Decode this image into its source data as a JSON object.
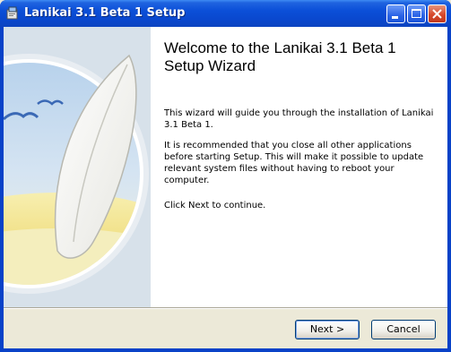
{
  "window": {
    "title": "Lanikai 3.1 Beta 1 Setup"
  },
  "wizard": {
    "heading": "Welcome to the Lanikai 3.1 Beta 1 Setup Wizard",
    "paragraphs": [
      "This wizard will guide you through the installation of Lanikai 3.1 Beta 1.",
      "It is recommended that you close all other applications before starting Setup. This will make it possible to update relevant system files without having to reboot your computer.",
      "Click Next to continue."
    ]
  },
  "buttons": {
    "next_label": "Next >",
    "cancel_label": "Cancel"
  },
  "icons": {
    "app": "installer-app-icon",
    "minimize": "minimize-icon",
    "maximize": "maximize-icon",
    "close": "close-icon",
    "banner": "surfboard-banner-image"
  },
  "colors": {
    "titlebar": "#0a47cd",
    "side_panel": "#d9e3ec",
    "client_bg": "#ece9d8"
  }
}
